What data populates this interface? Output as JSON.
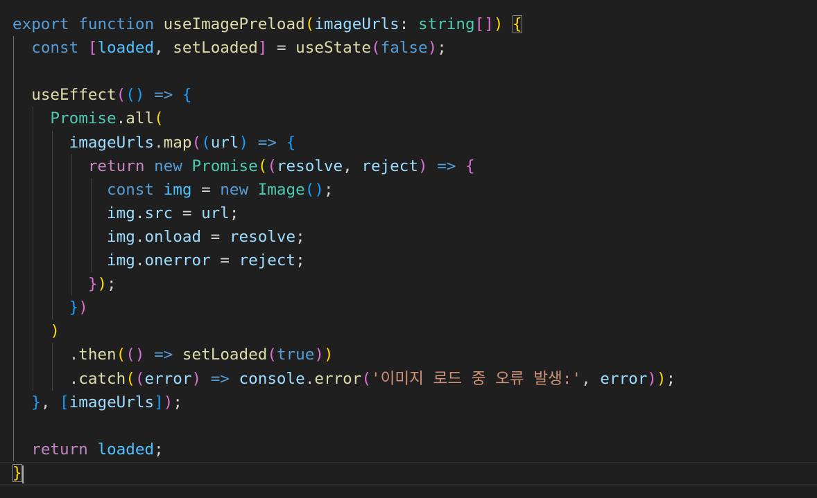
{
  "editor": {
    "theme": {
      "background": "#1f1f1f",
      "keyword": "#569cd6",
      "control": "#c586c0",
      "function": "#dcdcaa",
      "variable": "#9cdcfe",
      "type": "#4ec9b0",
      "string": "#ce9178",
      "bracket1": "#ffd700",
      "bracket2": "#da70d6",
      "bracket3": "#179fff"
    },
    "lines": [
      [
        [
          "kw",
          "export"
        ],
        [
          "pun",
          " "
        ],
        [
          "kw",
          "function"
        ],
        [
          "pun",
          " "
        ],
        [
          "fn",
          "useImagePreload"
        ],
        [
          "b1",
          "("
        ],
        [
          "var",
          "imageUrls"
        ],
        [
          "pun",
          ": "
        ],
        [
          "typ",
          "string"
        ],
        [
          "b2",
          "[]"
        ],
        [
          "b1",
          ")"
        ],
        [
          "pun",
          " "
        ],
        [
          "b1 bmatch",
          "{"
        ]
      ],
      [
        [
          "pun",
          "  "
        ],
        [
          "kw",
          "const"
        ],
        [
          "pun",
          " "
        ],
        [
          "b2",
          "["
        ],
        [
          "cst",
          "loaded"
        ],
        [
          "pun",
          ", "
        ],
        [
          "fn",
          "setLoaded"
        ],
        [
          "b2",
          "]"
        ],
        [
          "pun",
          " = "
        ],
        [
          "fn",
          "useState"
        ],
        [
          "b2",
          "("
        ],
        [
          "kw",
          "false"
        ],
        [
          "b2",
          ")"
        ],
        [
          "pun",
          ";"
        ]
      ],
      [],
      [
        [
          "pun",
          "  "
        ],
        [
          "fn",
          "useEffect"
        ],
        [
          "b2",
          "("
        ],
        [
          "b3",
          "()"
        ],
        [
          "pun",
          " "
        ],
        [
          "kw",
          "=>"
        ],
        [
          "pun",
          " "
        ],
        [
          "b3",
          "{"
        ]
      ],
      [
        [
          "pun",
          "    "
        ],
        [
          "typ",
          "Promise"
        ],
        [
          "pun",
          "."
        ],
        [
          "fn",
          "all"
        ],
        [
          "b1",
          "("
        ]
      ],
      [
        [
          "pun",
          "      "
        ],
        [
          "var",
          "imageUrls"
        ],
        [
          "pun",
          "."
        ],
        [
          "fn",
          "map"
        ],
        [
          "b2",
          "("
        ],
        [
          "b3",
          "("
        ],
        [
          "var",
          "url"
        ],
        [
          "b3",
          ")"
        ],
        [
          "pun",
          " "
        ],
        [
          "kw",
          "=>"
        ],
        [
          "pun",
          " "
        ],
        [
          "b3",
          "{"
        ]
      ],
      [
        [
          "pun",
          "        "
        ],
        [
          "ctl",
          "return"
        ],
        [
          "pun",
          " "
        ],
        [
          "kw",
          "new"
        ],
        [
          "pun",
          " "
        ],
        [
          "typ",
          "Promise"
        ],
        [
          "b1",
          "("
        ],
        [
          "b2",
          "("
        ],
        [
          "var",
          "resolve"
        ],
        [
          "pun",
          ", "
        ],
        [
          "var",
          "reject"
        ],
        [
          "b2",
          ")"
        ],
        [
          "pun",
          " "
        ],
        [
          "kw",
          "=>"
        ],
        [
          "pun",
          " "
        ],
        [
          "b2",
          "{"
        ]
      ],
      [
        [
          "pun",
          "          "
        ],
        [
          "kw",
          "const"
        ],
        [
          "pun",
          " "
        ],
        [
          "cst",
          "img"
        ],
        [
          "pun",
          " = "
        ],
        [
          "kw",
          "new"
        ],
        [
          "pun",
          " "
        ],
        [
          "typ",
          "Image"
        ],
        [
          "b3",
          "()"
        ],
        [
          "pun",
          ";"
        ]
      ],
      [
        [
          "pun",
          "          "
        ],
        [
          "var",
          "img"
        ],
        [
          "pun",
          "."
        ],
        [
          "var",
          "src"
        ],
        [
          "pun",
          " = "
        ],
        [
          "var",
          "url"
        ],
        [
          "pun",
          ";"
        ]
      ],
      [
        [
          "pun",
          "          "
        ],
        [
          "var",
          "img"
        ],
        [
          "pun",
          "."
        ],
        [
          "var",
          "onload"
        ],
        [
          "pun",
          " = "
        ],
        [
          "var",
          "resolve"
        ],
        [
          "pun",
          ";"
        ]
      ],
      [
        [
          "pun",
          "          "
        ],
        [
          "var",
          "img"
        ],
        [
          "pun",
          "."
        ],
        [
          "var",
          "onerror"
        ],
        [
          "pun",
          " = "
        ],
        [
          "var",
          "reject"
        ],
        [
          "pun",
          ";"
        ]
      ],
      [
        [
          "pun",
          "        "
        ],
        [
          "b2",
          "}"
        ],
        [
          "b1",
          ")"
        ],
        [
          "pun",
          ";"
        ]
      ],
      [
        [
          "pun",
          "      "
        ],
        [
          "b3",
          "}"
        ],
        [
          "b2",
          ")"
        ]
      ],
      [
        [
          "pun",
          "    "
        ],
        [
          "b1",
          ")"
        ]
      ],
      [
        [
          "pun",
          "      ."
        ],
        [
          "fn",
          "then"
        ],
        [
          "b1",
          "("
        ],
        [
          "b2",
          "()"
        ],
        [
          "pun",
          " "
        ],
        [
          "kw",
          "=>"
        ],
        [
          "pun",
          " "
        ],
        [
          "fn",
          "setLoaded"
        ],
        [
          "b2",
          "("
        ],
        [
          "kw",
          "true"
        ],
        [
          "b2",
          ")"
        ],
        [
          "b1",
          ")"
        ]
      ],
      [
        [
          "pun",
          "      ."
        ],
        [
          "fn",
          "catch"
        ],
        [
          "b1",
          "("
        ],
        [
          "b2",
          "("
        ],
        [
          "var",
          "error"
        ],
        [
          "b2",
          ")"
        ],
        [
          "pun",
          " "
        ],
        [
          "kw",
          "=>"
        ],
        [
          "pun",
          " "
        ],
        [
          "var",
          "console"
        ],
        [
          "pun",
          "."
        ],
        [
          "fn",
          "error"
        ],
        [
          "b2",
          "("
        ],
        [
          "str",
          "'이미지 로드 중 오류 발생:'"
        ],
        [
          "pun",
          ", "
        ],
        [
          "var",
          "error"
        ],
        [
          "b2",
          ")"
        ],
        [
          "b1",
          ")"
        ],
        [
          "pun",
          ";"
        ]
      ],
      [
        [
          "pun",
          "  "
        ],
        [
          "b3",
          "}"
        ],
        [
          "pun",
          ", "
        ],
        [
          "b3",
          "["
        ],
        [
          "var",
          "imageUrls"
        ],
        [
          "b3",
          "]"
        ],
        [
          "b2",
          ")"
        ],
        [
          "pun",
          ";"
        ]
      ],
      [],
      [
        [
          "pun",
          "  "
        ],
        [
          "ctl",
          "return"
        ],
        [
          "pun",
          " "
        ],
        [
          "cst",
          "loaded"
        ],
        [
          "pun",
          ";"
        ]
      ],
      [
        [
          "b1 bmatch",
          "}"
        ]
      ]
    ]
  }
}
